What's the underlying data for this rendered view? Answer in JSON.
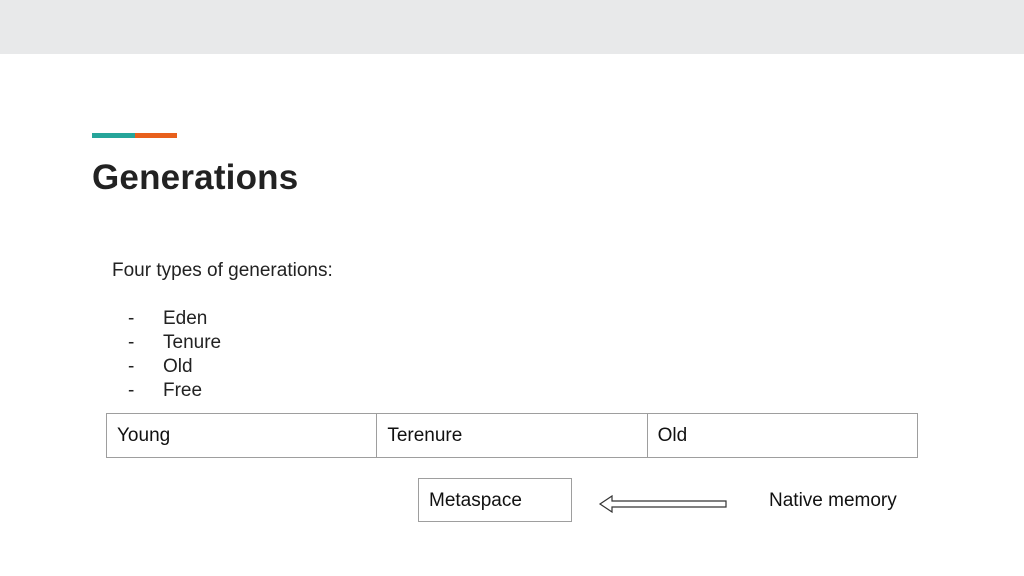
{
  "colors": {
    "accent_teal": "#26a59a",
    "accent_orange": "#e8601c",
    "topbar": "#e8e9ea"
  },
  "slide": {
    "title": "Generations",
    "intro": "Four types of generations:",
    "list_marker": "-",
    "items": [
      "Eden",
      "Tenure",
      "Old",
      "Free"
    ]
  },
  "table": {
    "cells": [
      "Young",
      "Terenure",
      "Old"
    ]
  },
  "metaspace": {
    "label": "Metaspace",
    "arrow_icon": "left-arrow-icon",
    "target_label": "Native memory"
  }
}
